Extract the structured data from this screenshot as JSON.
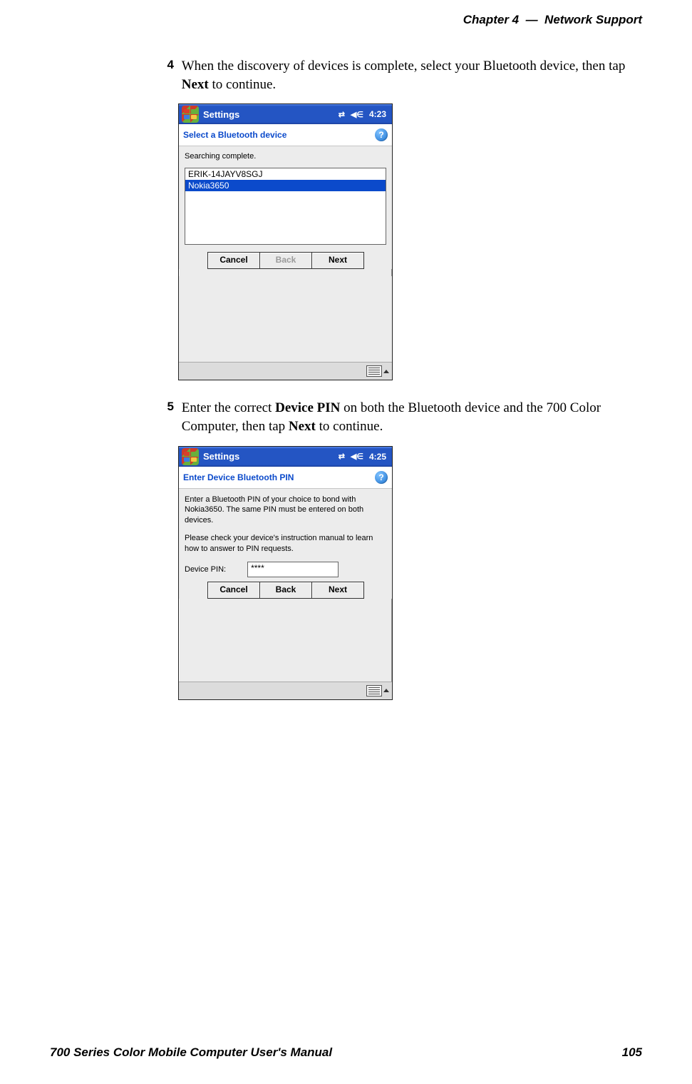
{
  "header": {
    "chapter": "Chapter  4",
    "dash": "—",
    "title": "Network Support"
  },
  "footer": {
    "left": "700 Series Color Mobile Computer User's Manual",
    "right": "105"
  },
  "steps": {
    "s4": {
      "num": "4",
      "pre": "When the discovery of devices is complete, select your Bluetooth device, then tap ",
      "bold": "Next",
      "post": " to continue."
    },
    "s5": {
      "num": "5",
      "pre": "Enter the correct ",
      "bold1": "Device PIN",
      "mid": " on both the Bluetooth device and the 700 Color Computer, then tap ",
      "bold2": "Next",
      "post": " to continue."
    }
  },
  "shot1": {
    "title": "Settings",
    "time": "4:23",
    "subtitle": "Select a Bluetooth device",
    "status": "Searching complete.",
    "items": [
      "ERIK-14JAYV8SGJ",
      "Nokia3650"
    ],
    "selected_index": 1,
    "buttons": {
      "cancel": "Cancel",
      "back": "Back",
      "next": "Next"
    }
  },
  "shot2": {
    "title": "Settings",
    "time": "4:25",
    "subtitle": "Enter Device Bluetooth PIN",
    "para1": "Enter a Bluetooth PIN of your choice to bond with Nokia3650. The same PIN must be entered on both devices.",
    "para2": "Please check your device's instruction manual to learn how to answer to PIN requests.",
    "pin_label": "Device PIN:",
    "pin_value": "****",
    "buttons": {
      "cancel": "Cancel",
      "back": "Back",
      "next": "Next"
    }
  }
}
